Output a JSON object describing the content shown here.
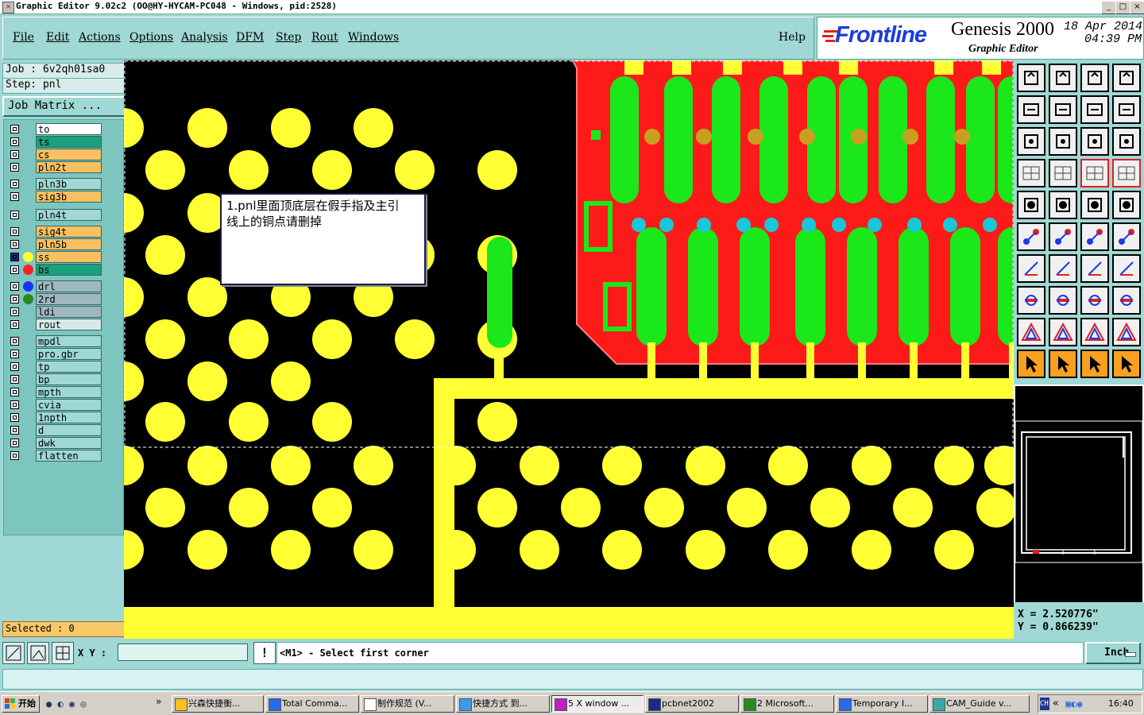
{
  "window": {
    "title": "Graphic Editor 9.02c2 (OO@HY-HYCAM-PC048 - Windows, pid:2528)",
    "minimize": "_",
    "maximize": "□",
    "close": "×"
  },
  "menu": {
    "file": "File",
    "edit": "Edit",
    "actions": "Actions",
    "options": "Options",
    "analysis": "Analysis",
    "dfm": "DFM",
    "step": "Step",
    "rout": "Rout",
    "windows": "Windows",
    "help": "Help"
  },
  "brand": {
    "logo": "Frontline",
    "product": "Genesis 2000",
    "subtitle": "Graphic Editor",
    "date": "18 Apr 2014",
    "time": "04:39 PM",
    "logo_color": "#1a3ed8",
    "accent_color": "#e02020"
  },
  "job": {
    "job_label": "Job : 6v2qh01sa0",
    "step_label": "Step: pnl",
    "matrix_button": "Job Matrix ..."
  },
  "layers": [
    {
      "name": "to",
      "bg": "#ffffff",
      "dot": ""
    },
    {
      "name": "ts",
      "bg": "#1aa07a",
      "dot": ""
    },
    {
      "name": "cs",
      "bg": "#f8c060",
      "dot": ""
    },
    {
      "name": "pln2t",
      "bg": "#f8c060",
      "dot": ""
    },
    {
      "name": "pln3b",
      "bg": "#9fd8d4",
      "dot": ""
    },
    {
      "name": "sig3b",
      "bg": "#f8c060",
      "dot": ""
    },
    {
      "name": "pln4t",
      "bg": "#9fd8d4",
      "dot": ""
    },
    {
      "name": "sig4t",
      "bg": "#f8c060",
      "dot": ""
    },
    {
      "name": "pln5b",
      "bg": "#f8c060",
      "dot": ""
    },
    {
      "name": "ss",
      "bg": "#f8c060",
      "dot": "#ffff33"
    },
    {
      "name": "bs",
      "bg": "#1aa07a",
      "dot": "#ff2020"
    },
    {
      "name": "drl",
      "bg": "#9fb8c0",
      "dot": "#1a30ff"
    },
    {
      "name": "2rd",
      "bg": "#9fb8c0",
      "dot": "#2a8a20"
    },
    {
      "name": "ldi",
      "bg": "#9fb8c0",
      "dot": ""
    },
    {
      "name": "rout",
      "bg": "#d8e8e8",
      "dot": ""
    },
    {
      "name": "mpdl",
      "bg": "#9fd8d4",
      "dot": ""
    },
    {
      "name": "pro.gbr",
      "bg": "#9fd8d4",
      "dot": ""
    },
    {
      "name": "tp",
      "bg": "#9fd8d4",
      "dot": ""
    },
    {
      "name": "bp",
      "bg": "#9fd8d4",
      "dot": ""
    },
    {
      "name": "mpth",
      "bg": "#9fd8d4",
      "dot": ""
    },
    {
      "name": "cvia",
      "bg": "#9fd8d4",
      "dot": ""
    },
    {
      "name": "1npth",
      "bg": "#9fd8d4",
      "dot": ""
    },
    {
      "name": "d",
      "bg": "#9fd8d4",
      "dot": ""
    },
    {
      "name": "dwk",
      "bg": "#9fd8d4",
      "dot": ""
    },
    {
      "name": "flatten",
      "bg": "#9fd8d4",
      "dot": ""
    }
  ],
  "selected": "Selected : 0",
  "note": {
    "text_line1": "1.pnl里面顶底层在假手指及主引",
    "text_line2": "线上的铜点请删掉"
  },
  "coords": {
    "x": "X = 2.520776\"",
    "y": "Y = 0.866239\""
  },
  "status": {
    "xy_label": "X Y :",
    "xy_value": "",
    "warn": "!",
    "prompt": "<M1> - Select first corner",
    "units": "Inch"
  },
  "taskbar": {
    "start": "开始",
    "items": [
      "兴森快捷衡...",
      "Total Comma...",
      "制作规范 (V...",
      "快捷方式 到...",
      "5 X window ...",
      "pcbnet2002",
      "2 Microsoft...",
      "Temporary I...",
      "CAM_Guide v..."
    ],
    "clock": "16:40",
    "tray_chevron": "«",
    "ime": "CH"
  },
  "colors": {
    "panel": "#9fd8d4",
    "pad_yellow": "#ffff33",
    "mask_red": "#ff1a1a",
    "copper_green": "#1ae81a",
    "cyan_hole": "#19c8d8",
    "olive_hole": "#c8a020"
  }
}
